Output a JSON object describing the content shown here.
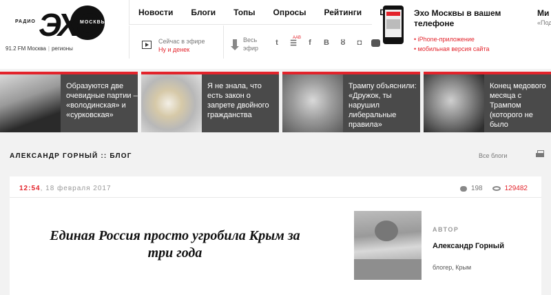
{
  "logo": {
    "left_word": "РАДИО",
    "big": "ЭХО",
    "right_word": "МОСКВЫ"
  },
  "header": {
    "frequency": "91.2 FM Москва",
    "regions": "регионы"
  },
  "nav": {
    "items": [
      "Новости",
      "Блоги",
      "Топы",
      "Опросы",
      "Рейтинги",
      "Doc"
    ]
  },
  "live": {
    "label": "Сейчас в эфире",
    "program": "Ну и денек"
  },
  "air": {
    "line1": "Весь",
    "line2": "эфир"
  },
  "socials": {
    "badge": "AAB",
    "icons": [
      "twitter-icon",
      "rss-icon",
      "facebook-icon",
      "vk-icon",
      "ok-icon",
      "instagram-icon",
      "youtube-icon"
    ]
  },
  "app": {
    "title": "Эхо Москвы в вашем телефоне",
    "links": [
      "iPhone-приложение",
      "мобильная версия сайта"
    ]
  },
  "side": {
    "title": "Ми",
    "sub": "«Под"
  },
  "news": [
    {
      "caption": "Образуются две очевидные партии – «володинская» и «сурковская»"
    },
    {
      "caption": "Я не знала, что есть закон о запрете двойного гражданства"
    },
    {
      "caption": "Трампу объяснили: «Дружок, ты нарушил либеральные правила»"
    },
    {
      "caption": "Конец медового месяца с Трампом (которого не было"
    }
  ],
  "blog": {
    "title": "АЛЕКСАНДР ГОРНЫЙ :: БЛОГ",
    "all_blogs": "Все блоги"
  },
  "article": {
    "time": "12:54",
    "date": ", 18 февраля 2017",
    "comments": "198",
    "views": "129482",
    "headline": "Единая Россия просто угробила Крым за три года",
    "author_label": "АВТОР",
    "author_name": "Александр Горный",
    "author_desc": "блогер, Крым"
  },
  "colors": {
    "accent": "#e3232b",
    "card_bg": "#4a4a4a",
    "page_bg": "#f2f2f2"
  }
}
